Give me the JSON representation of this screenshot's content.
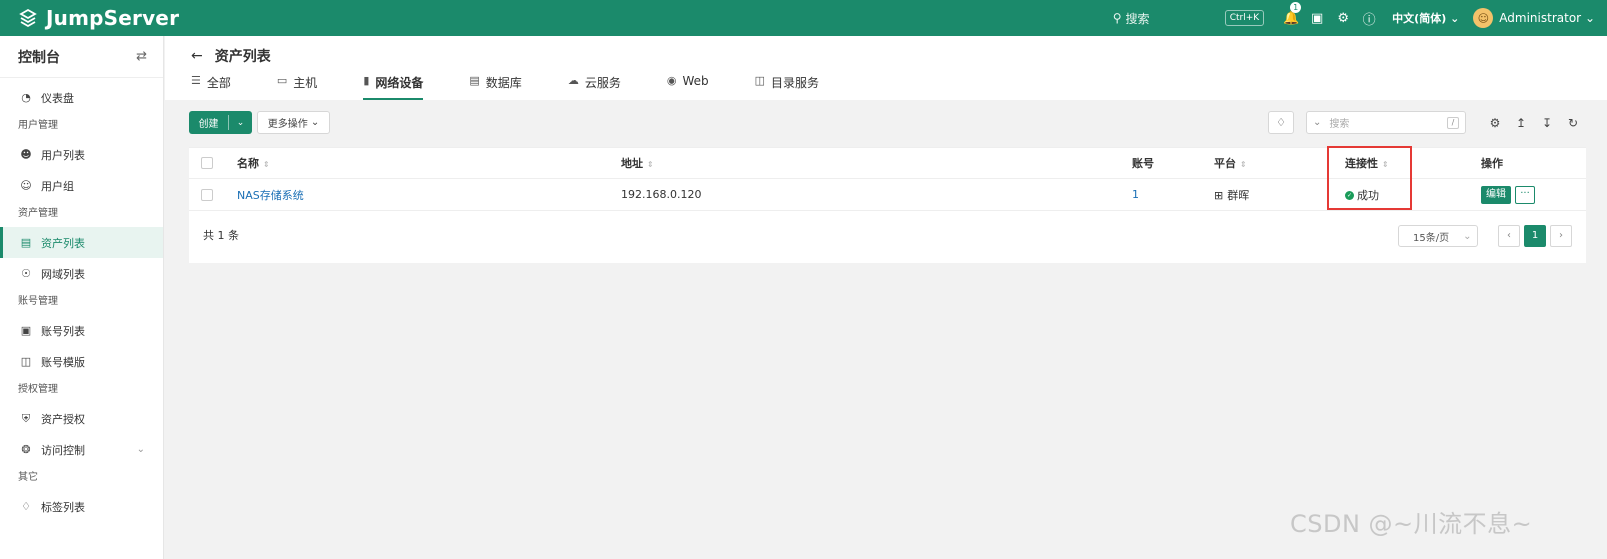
{
  "topbar": {
    "brand": "JumpServer",
    "search_label": "搜索",
    "search_shortcut": "Ctrl+K",
    "notifications_count": "1",
    "language": "中文(简体)",
    "user_name": "Administrator"
  },
  "sidebar": {
    "title": "控制台",
    "dashboard": "仪表盘",
    "groups": {
      "user_mgmt": "用户管理",
      "asset_mgmt": "资产管理",
      "account_mgmt": "账号管理",
      "perm_mgmt": "授权管理",
      "other": "其它"
    },
    "items": {
      "user_list": "用户列表",
      "user_group": "用户组",
      "asset_list": "资产列表",
      "zone_list": "网域列表",
      "account_list": "账号列表",
      "account_template": "账号模版",
      "asset_perm": "资产授权",
      "access_control": "访问控制",
      "label_list": "标签列表"
    }
  },
  "page": {
    "title": "资产列表",
    "tabs": [
      "全部",
      "主机",
      "网络设备",
      "数据库",
      "云服务",
      "Web",
      "目录服务"
    ],
    "active_tab": "网络设备"
  },
  "toolbar": {
    "create_label": "创建",
    "more_actions_label": "更多操作",
    "search_placeholder": "搜索",
    "search_shortcut": "/"
  },
  "table": {
    "columns": {
      "name": "名称",
      "address": "地址",
      "accounts": "账号",
      "platform": "平台",
      "connectivity": "连接性",
      "actions": "操作"
    },
    "rows": [
      {
        "name": "NAS存储系统",
        "address": "192.168.0.120",
        "accounts": "1",
        "platform": "群晖",
        "connectivity": "成功",
        "edit_label": "编辑",
        "more_label": "···"
      }
    ],
    "total_label": "共 1 条",
    "page_size": "15条/页",
    "current_page": "1"
  },
  "watermark": "CSDN @~川流不息~",
  "colors": {
    "brand": "#1b8a6b",
    "success": "#1b9c5a",
    "highlight": "#e53935"
  }
}
